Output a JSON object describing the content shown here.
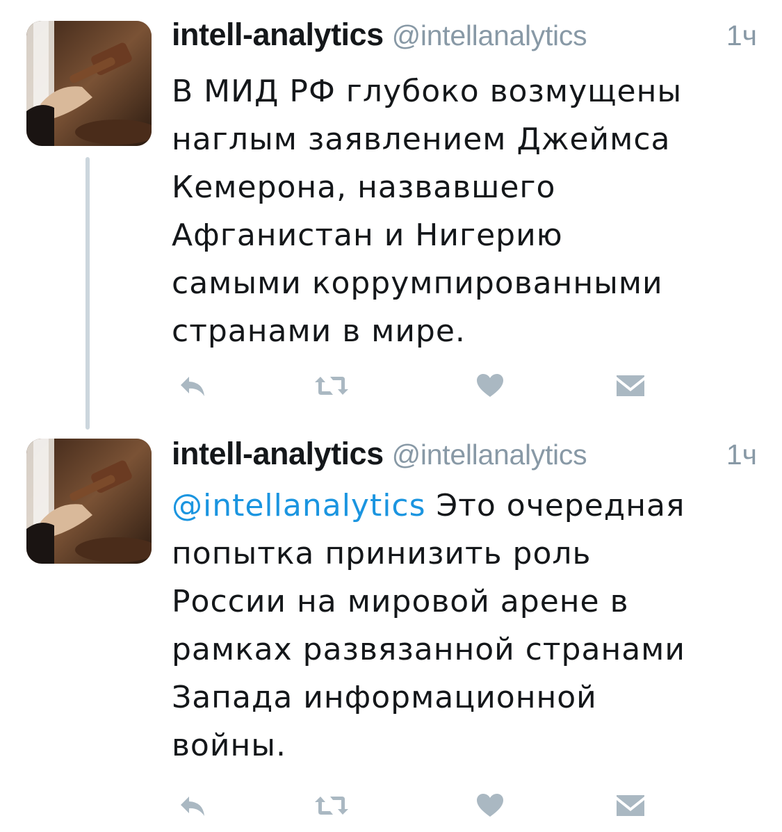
{
  "tweets": [
    {
      "display_name": "intell-analytics",
      "handle": "@intellanalytics",
      "time": "1ч",
      "mention": "",
      "text_lines": [
        "В МИД РФ глубоко возмущены",
        "наглым заявлением Джеймса",
        "Кемерона, назвавшего",
        "Афганистан и Нигерию",
        "самыми коррумпированными",
        "странами в мире."
      ],
      "avatar_icon": "judge-gavel-avatar",
      "actions": [
        "reply-icon",
        "retweet-icon",
        "like-icon",
        "direct-message-icon"
      ]
    },
    {
      "display_name": "intell-analytics",
      "handle": "@intellanalytics",
      "time": "1ч",
      "mention": "@intellanalytics",
      "text_first_line_rest": " Это очередная",
      "text_lines": [
        "попытка принизить роль",
        "России на мировой арене в",
        "рамках развязанной странами",
        "Запада информационной",
        "войны."
      ],
      "avatar_icon": "judge-gavel-avatar",
      "actions": [
        "reply-icon",
        "retweet-icon",
        "like-icon",
        "direct-message-icon"
      ]
    }
  ],
  "colors": {
    "text": "#14171a",
    "secondary": "#8899a6",
    "mention": "#1b95e0",
    "icon": "#aab8c2",
    "thread_line": "#ccd6dd"
  }
}
